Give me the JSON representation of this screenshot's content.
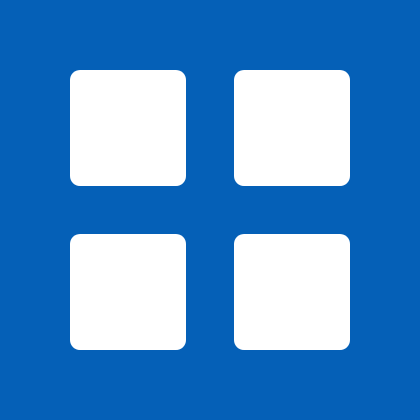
{
  "icon": {
    "name": "grid-icon",
    "background_color": "#0560b7",
    "tile_color": "#ffffff",
    "tiles": [
      "top-left",
      "top-right",
      "bottom-left",
      "bottom-right"
    ]
  }
}
